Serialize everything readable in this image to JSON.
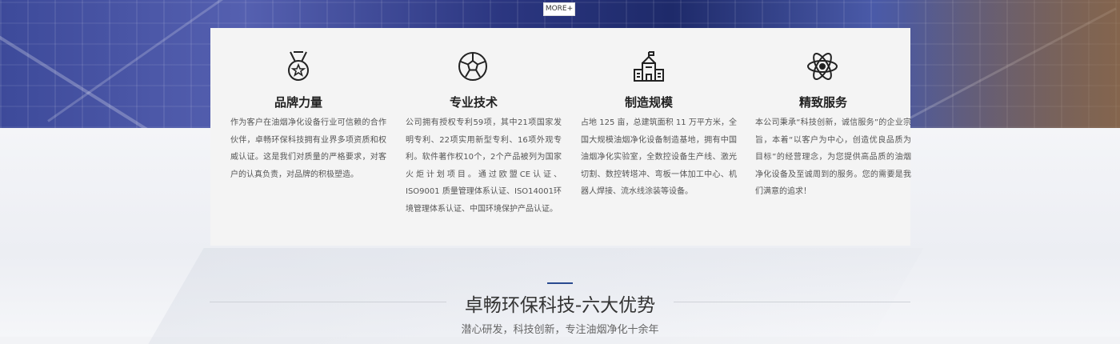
{
  "more_label": "MORE+",
  "features": [
    {
      "icon": "medal-icon",
      "title": "品牌力量",
      "desc": "作为客户在油烟净化设备行业可信赖的合作伙伴，卓畅环保科技拥有业界多项资质和权威认证。这是我们对质量的严格要求，对客户的认真负责，对品牌的积极塑造。"
    },
    {
      "icon": "soccer-ball-icon",
      "title": "专业技术",
      "desc": "公司拥有授权专利59项，其中21项国家发明专利、22项实用新型专利、16项外观专利。软件著作权10个，2个产品被列为国家火炬计划项目。通过欧盟CE认证、ISO9001 质量管理体系认证、ISO14001环境管理体系认证、中国环境保护产品认证。"
    },
    {
      "icon": "factory-icon",
      "title": "制造规模",
      "desc": "占地 125 亩，总建筑面积 11 万平方米，全国大规模油烟净化设备制造基地，拥有中国油烟净化实验室，全数控设备生产线、激光切割、数控转塔冲、弯板一体加工中心、机器人焊接、流水线涂装等设备。"
    },
    {
      "icon": "atom-icon",
      "title": "精致服务",
      "desc": "本公司秉承“科技创新，诚信服务”的企业宗旨，本着“以客户为中心，创造优良品质为目标”的经营理念，为您提供高品质的油烟净化设备及至诚周到的服务。您的需要是我们满意的追求！"
    }
  ],
  "section": {
    "heading": "卓畅环保科技-六大优势",
    "subheading": "潜心研发，科技创新，专注油烟净化十余年"
  },
  "colors": {
    "accent": "#2a4a90",
    "panel": "#f4f4f4"
  }
}
